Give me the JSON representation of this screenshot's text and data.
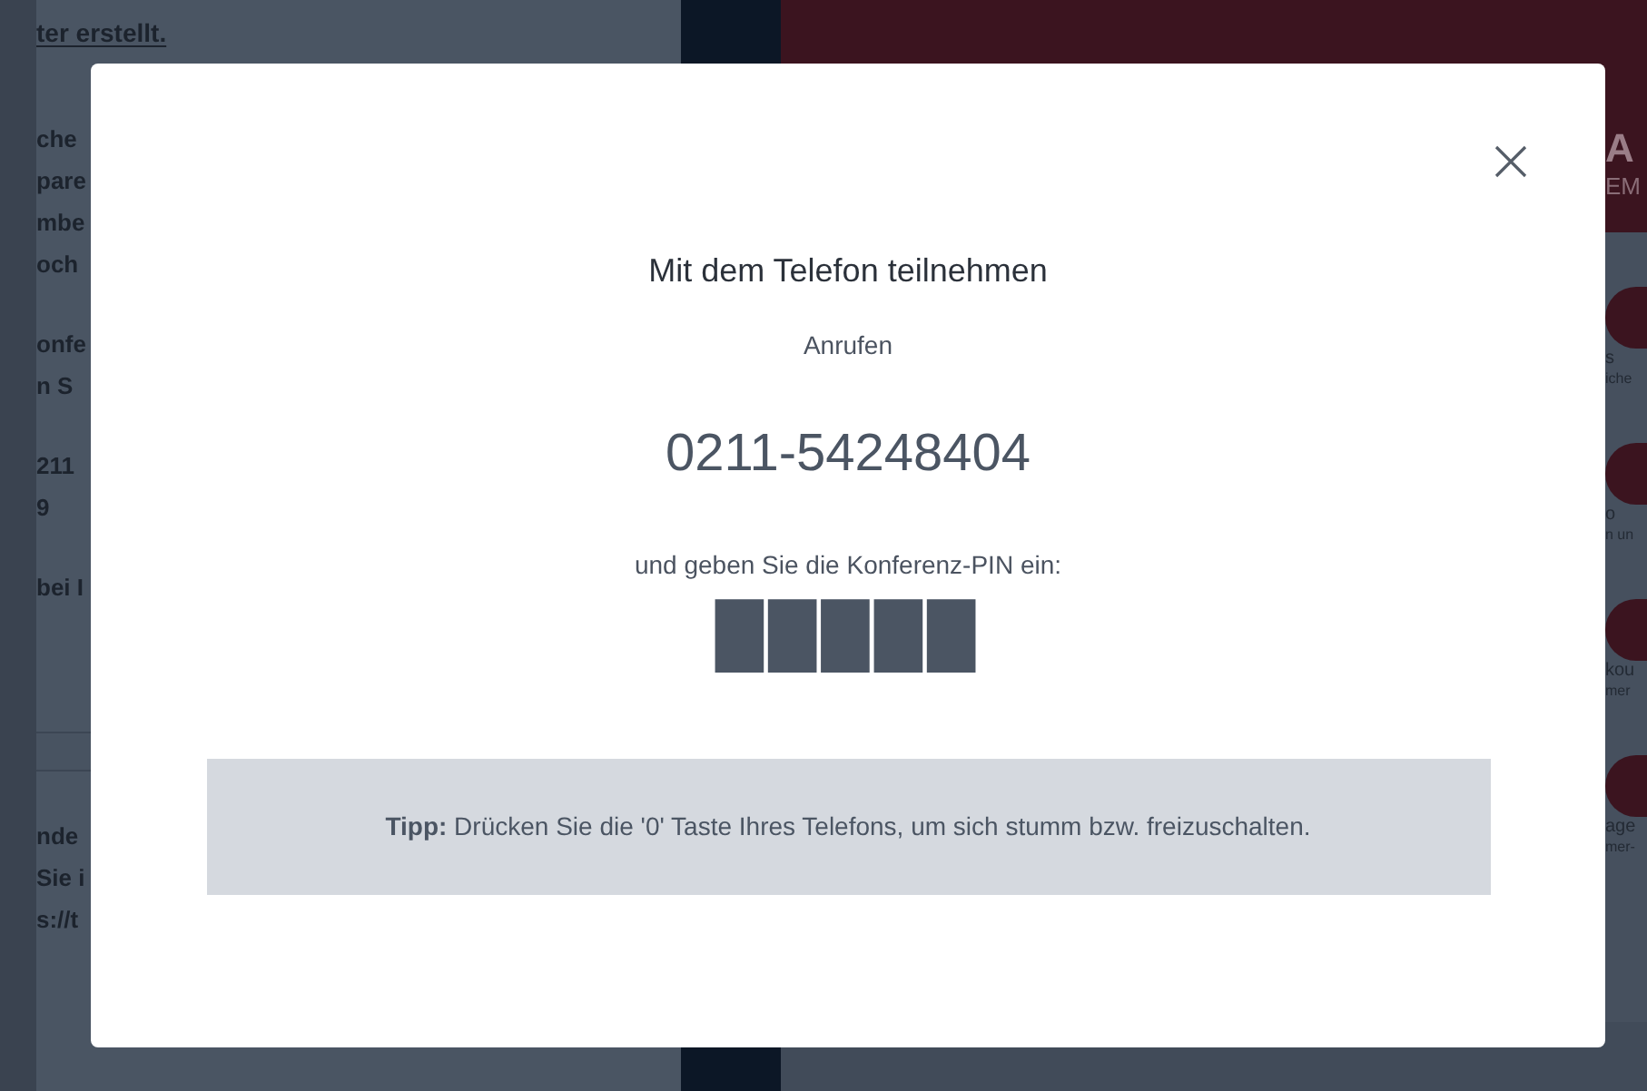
{
  "background_page": {
    "top_line": "ter erstellt.",
    "upper_paragraphs": [
      [
        "che",
        "pare",
        "mbe",
        "och"
      ],
      [
        "onfe",
        "n S"
      ],
      [
        "211",
        "9"
      ],
      [
        "bei I"
      ]
    ],
    "lower_paragraphs": [
      [
        "nde",
        "Sie i",
        "s://t"
      ]
    ],
    "logo": [
      "A",
      "EM"
    ],
    "side_actions": [
      {
        "line_1": "s",
        "line_2": "iche"
      },
      {
        "line_1": "o",
        "line_2": "n un"
      },
      {
        "line_1": "kou",
        "line_2": "mer"
      },
      {
        "line_1": "age",
        "line_2": "mer-"
      }
    ]
  },
  "dialog": {
    "title": "Mit dem Telefon teilnehmen",
    "subtitle": "Anrufen",
    "phone_number": "0211-54248404",
    "instruction": "und geben Sie die Konferenz-PIN ein:",
    "pin": "█████",
    "tip": "**Tipp:** Drücken Sie die '0' Taste Ihres Telefons, um sich stumm bzw. freizuschalten."
  }
}
